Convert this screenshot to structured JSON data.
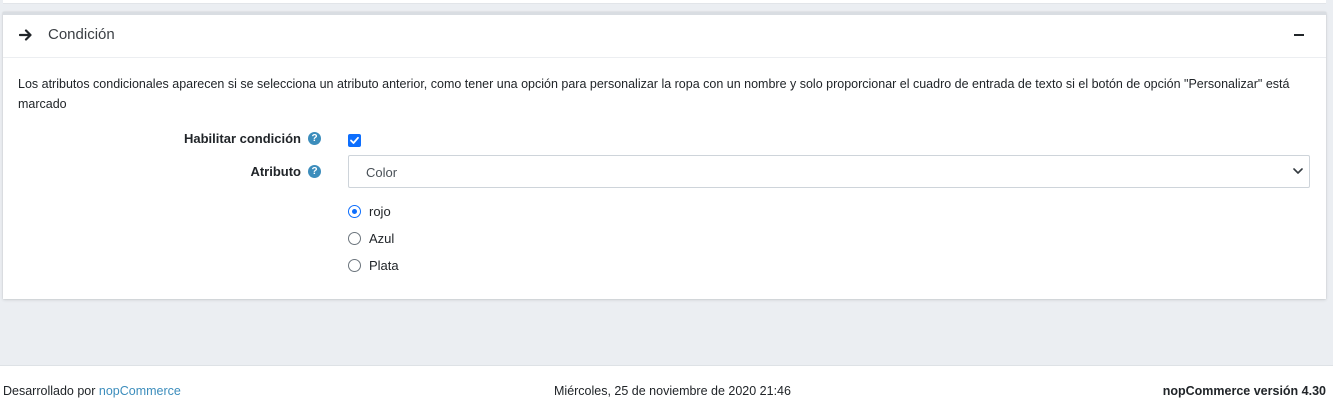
{
  "card": {
    "title": "Condición",
    "description": "Los atributos condicionales aparecen si se selecciona un atributo anterior, como tener una opción para personalizar la ropa con un nombre y solo proporcionar el cuadro de entrada de texto si el botón de opción \"Personalizar\" está marcado"
  },
  "form": {
    "enable_condition_label": "Habilitar condición",
    "enable_condition_checked": true,
    "attribute_label": "Atributo",
    "attribute_selected": "Color",
    "help_glyph": "?",
    "options": [
      {
        "label": "rojo",
        "checked": true
      },
      {
        "label": "Azul",
        "checked": false
      },
      {
        "label": "Plata",
        "checked": false
      }
    ]
  },
  "footer": {
    "powered_prefix": "Desarrollado por",
    "powered_link": "nopCommerce",
    "datetime": "Miércoles, 25 de noviembre de 2020 21:46",
    "version": "nopCommerce versión 4.30"
  },
  "colors": {
    "accent": "#0d6efd",
    "help": "#3c8dbc",
    "background": "#ebeef2"
  },
  "icons": {
    "header": "arrow-right-icon",
    "collapse": "minus-icon",
    "help": "question-circle-icon",
    "select": "chevron-down-icon"
  }
}
